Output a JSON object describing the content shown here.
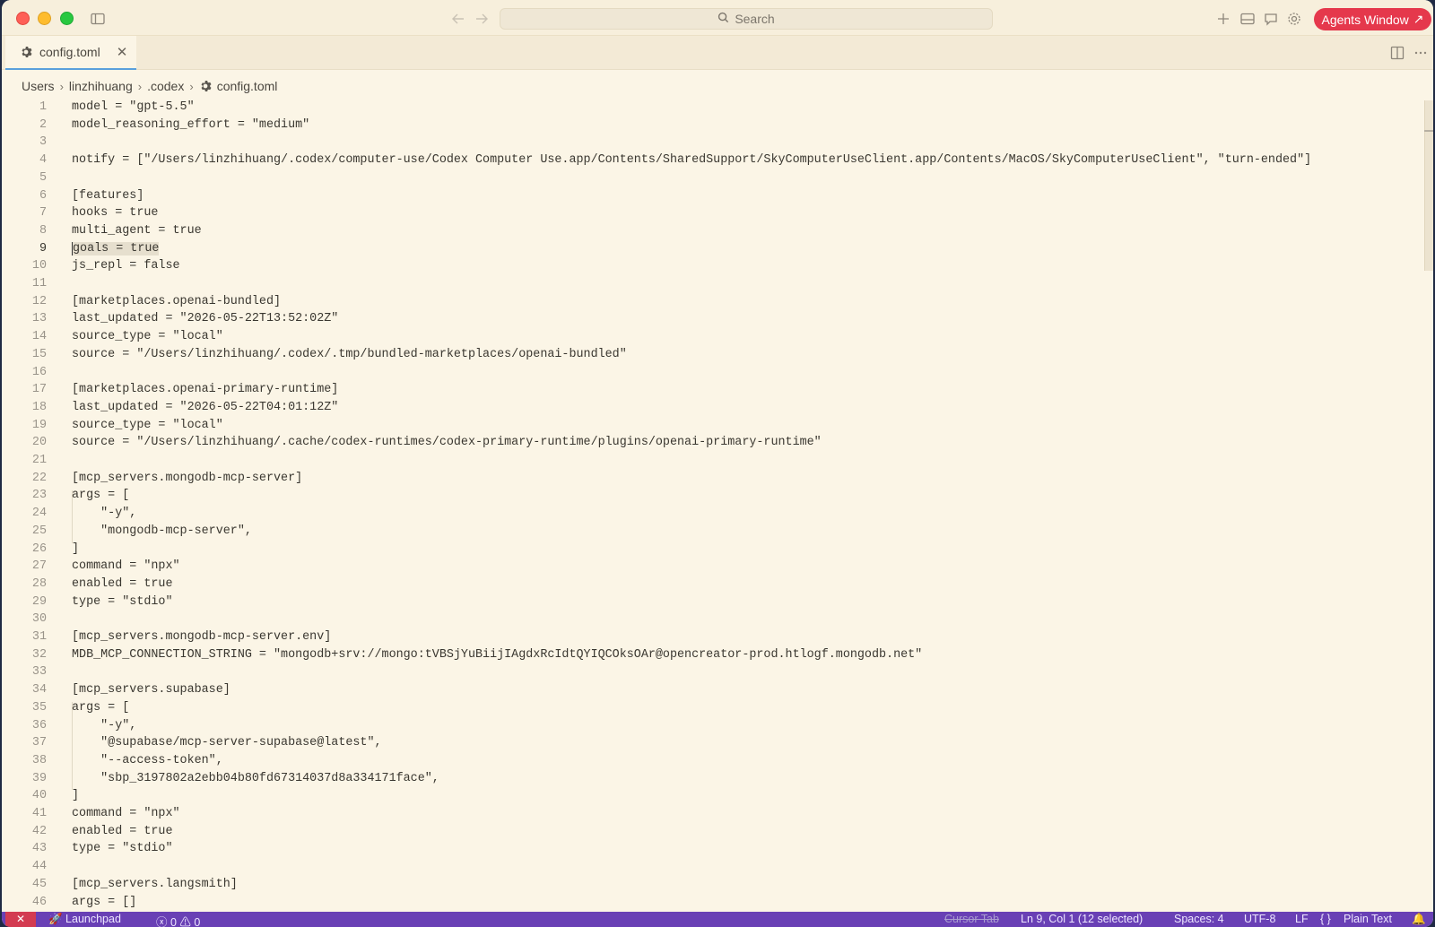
{
  "titlebar": {
    "search_placeholder": "Search",
    "agents_button": "Agents Window",
    "agents_arrow": "↗"
  },
  "tab": {
    "label": "config.toml",
    "close": "✕"
  },
  "breadcrumb": {
    "items": [
      "Users",
      "linzhihuang",
      ".codex",
      "config.toml"
    ],
    "separator": "›"
  },
  "editor": {
    "active_line": 9,
    "selection": {
      "line": 9,
      "text": "goals = true"
    },
    "lines": [
      "model = \"gpt-5.5\"",
      "model_reasoning_effort = \"medium\"",
      "",
      "notify = [\"/Users/linzhihuang/.codex/computer-use/Codex Computer Use.app/Contents/SharedSupport/SkyComputerUseClient.app/Contents/MacOS/SkyComputerUseClient\", \"turn-ended\"]",
      "",
      "[features]",
      "hooks = true",
      "multi_agent = true",
      "goals = true",
      "js_repl = false",
      "",
      "[marketplaces.openai-bundled]",
      "last_updated = \"2026-05-22T13:52:02Z\"",
      "source_type = \"local\"",
      "source = \"/Users/linzhihuang/.codex/.tmp/bundled-marketplaces/openai-bundled\"",
      "",
      "[marketplaces.openai-primary-runtime]",
      "last_updated = \"2026-05-22T04:01:12Z\"",
      "source_type = \"local\"",
      "source = \"/Users/linzhihuang/.cache/codex-runtimes/codex-primary-runtime/plugins/openai-primary-runtime\"",
      "",
      "[mcp_servers.mongodb-mcp-server]",
      "args = [",
      "    \"-y\",",
      "    \"mongodb-mcp-server\",",
      "]",
      "command = \"npx\"",
      "enabled = true",
      "type = \"stdio\"",
      "",
      "[mcp_servers.mongodb-mcp-server.env]",
      "MDB_MCP_CONNECTION_STRING = \"mongodb+srv://mongo:tVBSjYuBiijIAgdxRcIdtQYIQCOksOAr@opencreator-prod.htlogf.mongodb.net\"",
      "",
      "[mcp_servers.supabase]",
      "args = [",
      "    \"-y\",",
      "    \"@supabase/mcp-server-supabase@latest\",",
      "    \"--access-token\",",
      "    \"sbp_3197802a2ebb04b80fd67314037d8a334171face\",",
      "]",
      "command = \"npx\"",
      "enabled = true",
      "type = \"stdio\"",
      "",
      "[mcp_servers.langsmith]",
      "args = []"
    ]
  },
  "statusbar": {
    "remote": "✕",
    "launchpad": "Launchpad",
    "errors": "0",
    "warnings": "0",
    "cursor_tab": "Cursor Tab",
    "position": "Ln 9, Col 1 (12 selected)",
    "spaces": "Spaces: 4",
    "encoding": "UTF-8",
    "eol": "LF",
    "language_braces": "{ }",
    "language": "Plain Text"
  },
  "colors": {
    "editor_bg": "#fbf5e6",
    "status_bg": "#6940b5",
    "agents_button": "#e5384c",
    "tab_accent": "#5aa0dc"
  }
}
